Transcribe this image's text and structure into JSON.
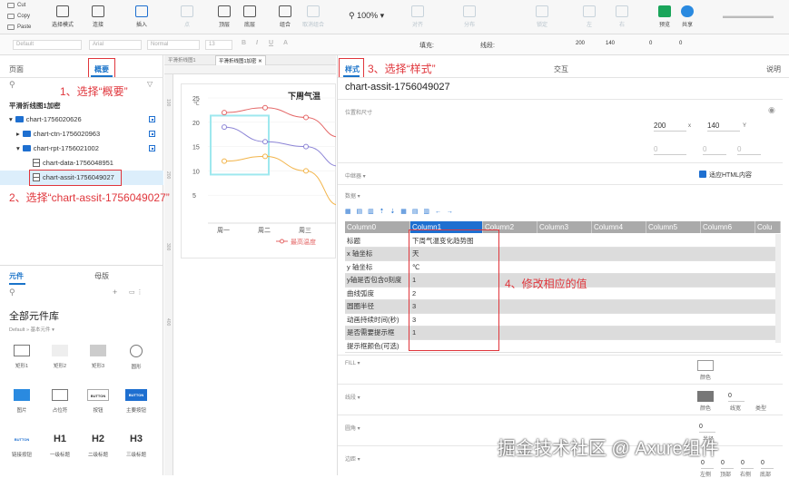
{
  "toolbar": {
    "clipboard": [
      "Cut",
      "Copy",
      "Paste"
    ],
    "buttons": [
      "选择模式",
      "连接",
      "插入",
      "点",
      "顶层",
      "底层",
      "组合",
      "取消组合",
      "对齐",
      "分布",
      "锁定",
      "左",
      "右",
      "预览",
      "共享"
    ],
    "zoom": "100%"
  },
  "format": {
    "style": "Default",
    "font": "Arial",
    "weight": "Normal",
    "size": "13",
    "fill_label": "填充:",
    "line_label": "线段:",
    "x": "200",
    "y": "140",
    "w": "0",
    "h": "0"
  },
  "left": {
    "tabs": [
      "页面",
      "概要"
    ],
    "outline_title": "平滑折线图1加密",
    "tree": [
      "chart-1756020626",
      "chart-ctn-1756020963",
      "chart-rpt-1756021002",
      "chart-data-1756048951",
      "chart-assit-1756049027"
    ],
    "lib_tabs": [
      "元件",
      "母版"
    ],
    "lib_title": "全部元件库",
    "lib_sub": "Default » 基本元件 ▾",
    "lib_items": [
      "矩形1",
      "矩形2",
      "矩形3",
      "圆形",
      "图片",
      "占位符",
      "按钮",
      "主要按钮",
      "链接按钮",
      "一级标题",
      "二级标题",
      "三级标题"
    ],
    "lib_glyph_texts": [
      "BUTTON",
      "BUTTON",
      "BUTTON",
      "H1",
      "H2",
      "H3"
    ]
  },
  "canvas": {
    "tabs": [
      "平滑折线图1",
      "平滑折线图1加密"
    ],
    "ruler": [
      "100",
      "200",
      "300",
      "400"
    ],
    "chart_title": "下周气温",
    "unit": "℃",
    "legend": "最高温度",
    "chart_data": {
      "type": "line",
      "title": "下周气温",
      "ylabel": "℃",
      "categories": [
        "周一",
        "周二",
        "周三"
      ],
      "ylim": [
        0,
        25
      ],
      "yticks": [
        25,
        20,
        15,
        10,
        5
      ],
      "series": [
        {
          "name": "最高温度",
          "color": "#e46666",
          "values": [
            22,
            23,
            21
          ]
        },
        {
          "color": "#8c84d6",
          "values": [
            19,
            16,
            15
          ]
        },
        {
          "color": "#f2b44a",
          "values": [
            12,
            13,
            10
          ]
        }
      ]
    }
  },
  "right": {
    "tabs": [
      "样式",
      "交互",
      "说明"
    ],
    "name": "chart-assit-1756049027",
    "pos_label": "位置和尺寸",
    "x": "200",
    "y": "140",
    "x_lab": "x",
    "y_lab": "Y",
    "zero": [
      "0",
      "0",
      "0"
    ],
    "anchor_label": "中继器 ▾",
    "fit_html": "适应HTML内容",
    "data_label": "数据 ▾",
    "columns": [
      "Column0",
      "Column1",
      "Column2",
      "Column3",
      "Column4",
      "Column5",
      "Column6",
      "Colu"
    ],
    "rows": [
      [
        "标题",
        "下周气温变化趋势图"
      ],
      [
        "x 轴坐标",
        "天"
      ],
      [
        "y 轴坐标",
        "℃"
      ],
      [
        "y轴是否包含0刻度",
        "1"
      ],
      [
        "曲线弧度",
        "2"
      ],
      [
        "圆圈半径",
        "3"
      ],
      [
        "动画持续时间(秒)",
        "3"
      ],
      [
        "是否需要提示框",
        "1"
      ],
      [
        "提示框颜色(可选)",
        ""
      ]
    ],
    "fill_label": "FILL ▾",
    "color": "颜色",
    "line_label": "线段 ▾",
    "line_w": "0",
    "lw": "线宽",
    "type": "类型",
    "corner_label": "圆角 ▾",
    "radius": "0",
    "radius_lab": "半径",
    "pad_label": "边距 ▾",
    "pads": [
      "0",
      "0",
      "0",
      "0"
    ],
    "pad_labs": [
      "左侧",
      "顶部",
      "右侧",
      "底部"
    ]
  },
  "annotations": [
    "1、选择“概要”",
    "2、选择“chart-assit-1756049027”",
    "3、选择“样式”",
    "4、修改相应的值"
  ],
  "watermark": "掘金技术社区 @ Axure组件",
  "user": "▬▬▬▬▬▬▬"
}
